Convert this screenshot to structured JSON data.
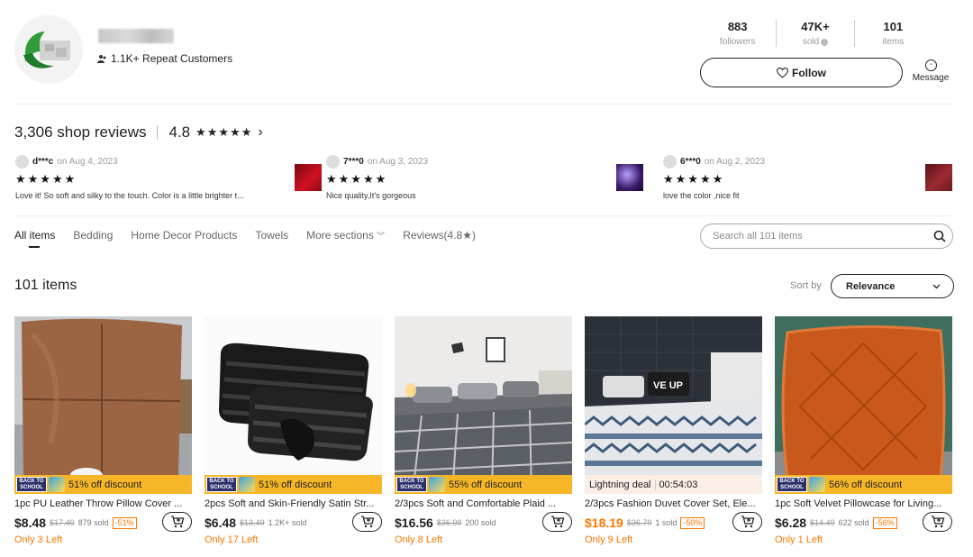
{
  "shop": {
    "repeat_customers": "1.1K+ Repeat Customers",
    "stats": [
      {
        "value": "883",
        "label": "followers"
      },
      {
        "value": "47K+",
        "label": "sold"
      },
      {
        "value": "101",
        "label": "items"
      }
    ],
    "follow_label": "Follow",
    "message_label": "Message"
  },
  "reviews": {
    "count_text": "3,306 shop reviews",
    "rating": "4.8",
    "stars": "★★★★★",
    "items": [
      {
        "user": "d***c",
        "date": "on Aug 4, 2023",
        "stars": "★★★★★",
        "text": "Love it! So soft and silky to the touch. Color is a little brighter t..."
      },
      {
        "user": "7***0",
        "date": "on Aug 3, 2023",
        "stars": "★★★★★",
        "text": "Nice quality,It's gorgeous"
      },
      {
        "user": "6***0",
        "date": "on Aug 2, 2023",
        "stars": "★★★★★",
        "text": "love the color ,nice fit"
      }
    ]
  },
  "tabs": [
    "All items",
    "Bedding",
    "Home Decor Products",
    "Towels",
    "More sections",
    "Reviews(4.8★)"
  ],
  "search": {
    "placeholder": "Search all 101 items"
  },
  "listing": {
    "count": "101 items",
    "sort_label": "Sort by",
    "sort_value": "Relevance"
  },
  "products": [
    {
      "banner": "51% off discount",
      "title": "1pc PU Leather Throw Pillow Cover ...",
      "price": "$8.48",
      "old_price": "$17.49",
      "sold": "879 sold",
      "badge": "-51%",
      "left": "Only 3 Left"
    },
    {
      "banner": "51% off discount",
      "title": "2pcs Soft and Skin-Friendly Satin Str...",
      "price": "$6.48",
      "old_price": "$13.49",
      "sold": "1.2K+ sold",
      "badge": "",
      "left": "Only 17 Left"
    },
    {
      "banner": "55% off discount",
      "title": "2/3pcs Soft and Comfortable Plaid ...",
      "price": "$16.56",
      "old_price": "$36.99",
      "sold": "200 sold",
      "badge": "",
      "left": "Only 8 Left"
    },
    {
      "banner": "Lightning deal",
      "timer": "00:54:03",
      "title": "2/3pcs Fashion Duvet Cover Set, Ele...",
      "price": "$18.19",
      "old_price": "$36.79",
      "sold": "1 sold",
      "badge": "-50%",
      "left": "Only 9 Left"
    },
    {
      "banner": "56% off discount",
      "title": "1pc Soft Velvet Pillowcase for Living...",
      "price": "$6.28",
      "old_price": "$14.49",
      "sold": "622 sold",
      "badge": "-56%",
      "left": "Only 1 Left"
    }
  ],
  "colors": {
    "accent_orange": "#fb7701",
    "promo_yellow": "#f6b628"
  }
}
